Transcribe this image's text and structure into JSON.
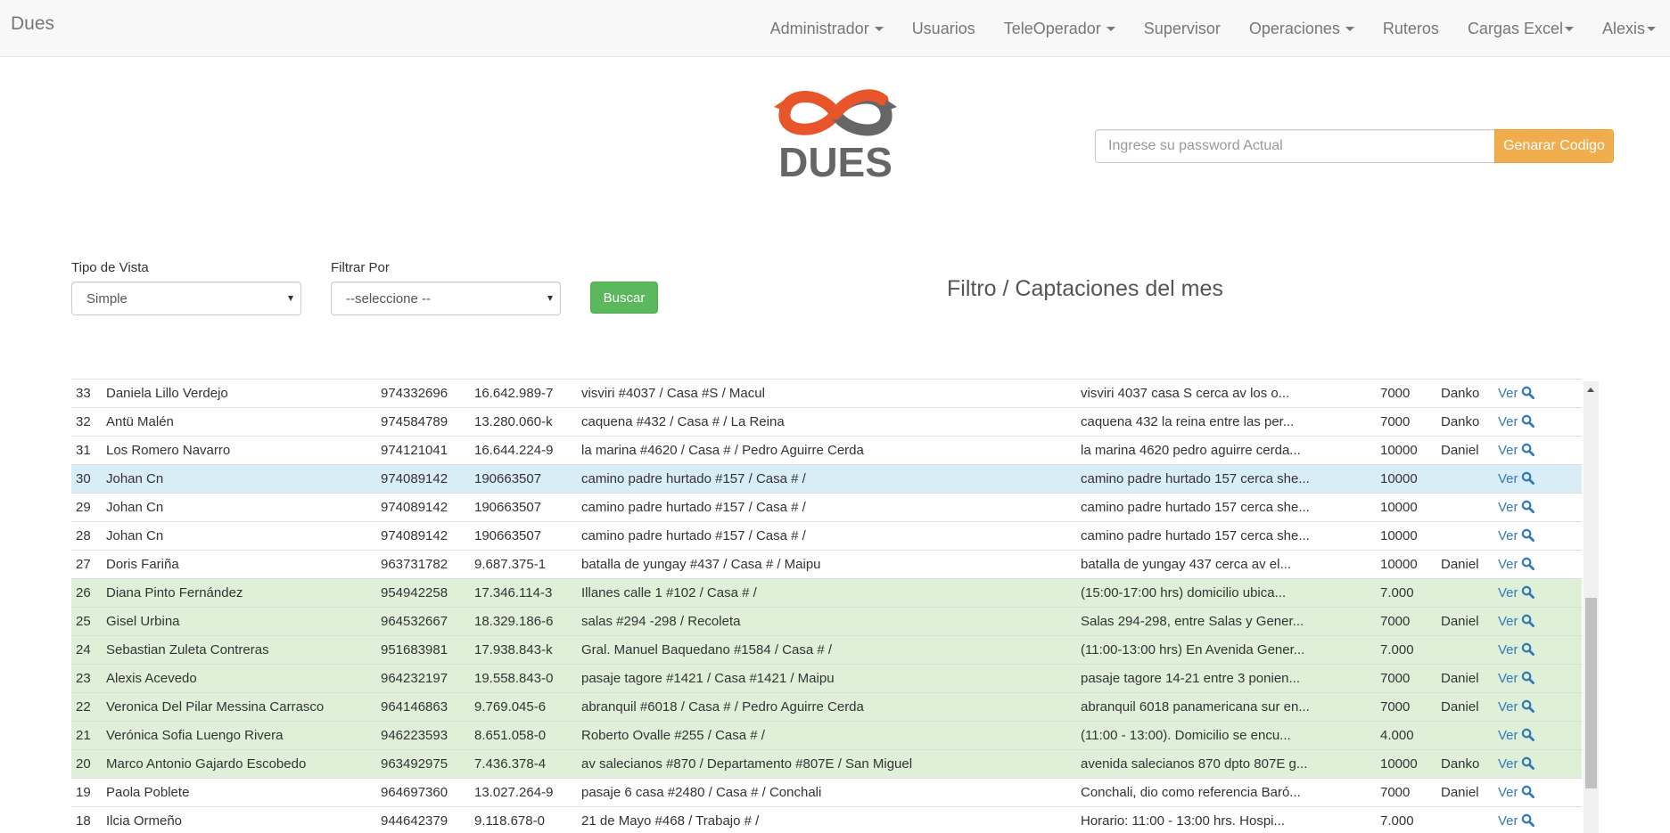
{
  "navbar": {
    "brand": "Dues",
    "items": [
      {
        "label": "Administrador",
        "dropdown": true
      },
      {
        "label": "Usuarios",
        "dropdown": false
      },
      {
        "label": "TeleOperador",
        "dropdown": true
      },
      {
        "label": "Supervisor",
        "dropdown": false
      },
      {
        "label": "Operaciones",
        "dropdown": true
      },
      {
        "label": "Ruteros",
        "dropdown": false
      },
      {
        "label": "Cargas Excel",
        "dropdown": true
      },
      {
        "label": "Alexis",
        "dropdown": true
      }
    ]
  },
  "logo": {
    "text": "DUES",
    "colors": {
      "loop_left": "#e8552b",
      "loop_right": "#666666",
      "text": "#666666"
    }
  },
  "password": {
    "placeholder": "Ingrese su password Actual",
    "value": "",
    "button_label": "Genarar Codigo"
  },
  "filters": {
    "tipo_vista_label": "Tipo de Vista",
    "tipo_vista_value": "Simple",
    "filtrar_por_label": "Filtrar Por",
    "filtrar_por_value": "--seleccione --",
    "buscar_label": "Buscar"
  },
  "heading": "Filtro / Captaciones del mes",
  "table": {
    "link_label": "Ver",
    "rows": [
      {
        "id": "33",
        "name": "Daniela Lillo Verdejo",
        "phone": "974332696",
        "rut": "16.642.989-7",
        "address": "visviri #4037 / Casa #S / Macul",
        "note": "visviri 4037 casa S cerca av los o...",
        "amount": "7000",
        "seller": "Danko",
        "status": "default"
      },
      {
        "id": "32",
        "name": "Antü Malén",
        "phone": "974584789",
        "rut": "13.280.060-k",
        "address": "caquena #432 / Casa # / La Reina",
        "note": "caquena 432 la reina entre las per...",
        "amount": "7000",
        "seller": "Danko",
        "status": "default"
      },
      {
        "id": "31",
        "name": "Los Romero Navarro",
        "phone": "974121041",
        "rut": "16.644.224-9",
        "address": "la marina #4620 / Casa # / Pedro Aguirre Cerda",
        "note": "la marina 4620 pedro aguirre cerda...",
        "amount": "10000",
        "seller": "Daniel",
        "status": "default"
      },
      {
        "id": "30",
        "name": "Johan Cn",
        "phone": "974089142",
        "rut": "190663507",
        "address": "camino padre hurtado #157 / Casa # /",
        "note": "camino padre hurtado 157 cerca she...",
        "amount": "10000",
        "seller": "",
        "status": "info"
      },
      {
        "id": "29",
        "name": "Johan Cn",
        "phone": "974089142",
        "rut": "190663507",
        "address": "camino padre hurtado #157 / Casa # /",
        "note": "camino padre hurtado 157 cerca she...",
        "amount": "10000",
        "seller": "",
        "status": "default"
      },
      {
        "id": "28",
        "name": "Johan Cn",
        "phone": "974089142",
        "rut": "190663507",
        "address": "camino padre hurtado #157 / Casa # /",
        "note": "camino padre hurtado 157 cerca she...",
        "amount": "10000",
        "seller": "",
        "status": "default"
      },
      {
        "id": "27",
        "name": "Doris Fariña",
        "phone": "963731782",
        "rut": "9.687.375-1",
        "address": "batalla de yungay #437 / Casa # / Maipu",
        "note": "batalla de yungay 437 cerca av el...",
        "amount": "10000",
        "seller": "Daniel",
        "status": "default"
      },
      {
        "id": "26",
        "name": "Diana Pinto Fernández",
        "phone": "954942258",
        "rut": "17.346.114-3",
        "address": "Illanes calle 1 #102 / Casa # /",
        "note": "(15:00-17:00 hrs) domicilio ubica...",
        "amount": "7.000",
        "seller": "",
        "status": "success"
      },
      {
        "id": "25",
        "name": "Gisel Urbina",
        "phone": "964532667",
        "rut": "18.329.186-6",
        "address": "salas #294 -298 / Recoleta",
        "note": "Salas 294-298, entre Salas y Gener...",
        "amount": "7000",
        "seller": "Daniel",
        "status": "success"
      },
      {
        "id": "24",
        "name": "Sebastian Zuleta Contreras",
        "phone": "951683981",
        "rut": "17.938.843-k",
        "address": "Gral. Manuel Baquedano #1584 / Casa # /",
        "note": "(11:00-13:00 hrs) En Avenida Gener...",
        "amount": "7.000",
        "seller": "",
        "status": "success"
      },
      {
        "id": "23",
        "name": "Alexis Acevedo",
        "phone": "964232197",
        "rut": "19.558.843-0",
        "address": "pasaje tagore #1421 / Casa #1421 / Maipu",
        "note": "pasaje tagore 14-21 entre 3 ponien...",
        "amount": "7000",
        "seller": "Daniel",
        "status": "success"
      },
      {
        "id": "22",
        "name": "Veronica Del Pilar Messina Carrasco",
        "phone": "964146863",
        "rut": "9.769.045-6",
        "address": "abranquil #6018 / Casa # / Pedro Aguirre Cerda",
        "note": "abranquil 6018 panamericana sur en...",
        "amount": "7000",
        "seller": "Daniel",
        "status": "success"
      },
      {
        "id": "21",
        "name": "Verónica Sofia Luengo Rivera",
        "phone": "946223593",
        "rut": "8.651.058-0",
        "address": "Roberto Ovalle #255 / Casa # /",
        "note": "(11:00 - 13:00). Domicilio se encu...",
        "amount": "4.000",
        "seller": "",
        "status": "success"
      },
      {
        "id": "20",
        "name": "Marco Antonio Gajardo Escobedo",
        "phone": "963492975",
        "rut": "7.436.378-4",
        "address": "av salecianos #870 / Departamento #807E / San Miguel",
        "note": "avenida salecianos 870 dpto 807E g...",
        "amount": "10000",
        "seller": "Danko",
        "status": "success"
      },
      {
        "id": "19",
        "name": "Paola Poblete",
        "phone": "964697360",
        "rut": "13.027.264-9",
        "address": "pasaje 6 casa #2480 / Casa # / Conchali",
        "note": "Conchali, dio como referencia Baró...",
        "amount": "7000",
        "seller": "Daniel",
        "status": "default"
      },
      {
        "id": "18",
        "name": "Ilcia Ormeño",
        "phone": "944642379",
        "rut": "9.118.678-0",
        "address": "21 de Mayo #468 / Trabajo # /",
        "note": "Horario: 11:00 - 13:00 hrs. Hospi...",
        "amount": "7.000",
        "seller": "",
        "status": "default"
      }
    ]
  }
}
